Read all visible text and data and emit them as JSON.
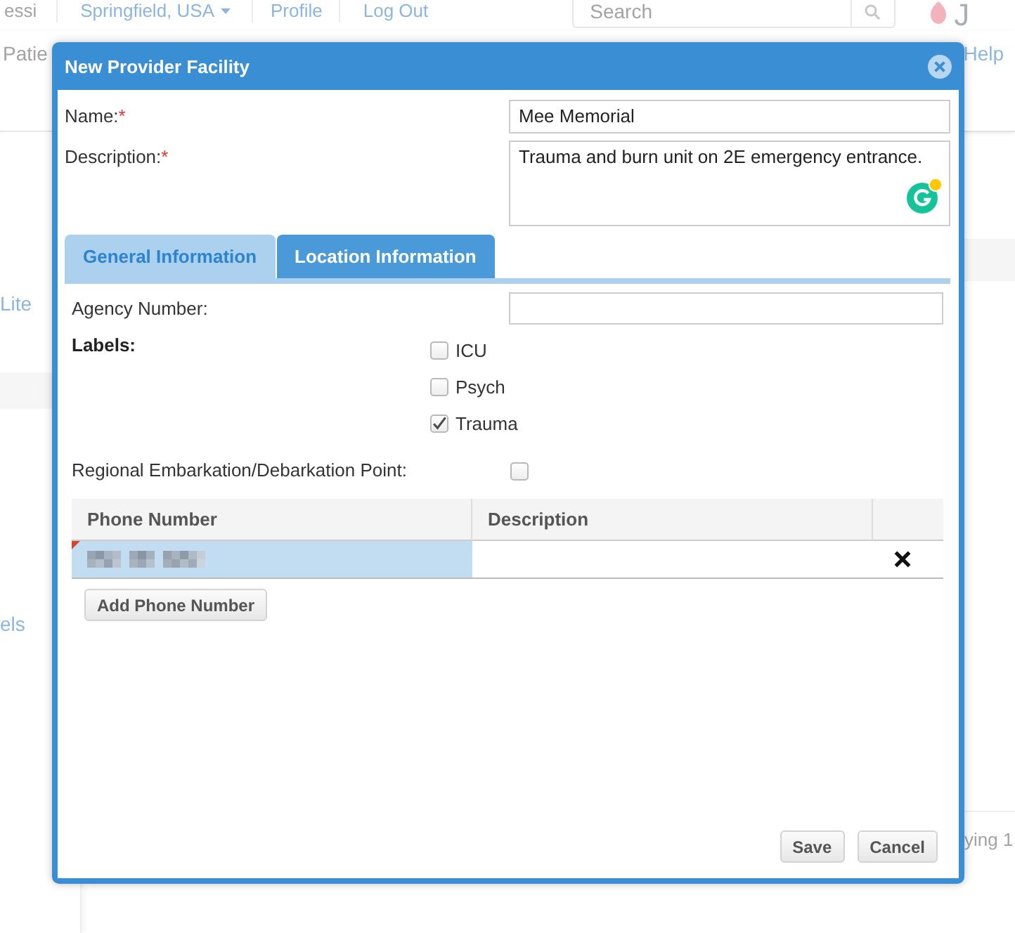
{
  "background_page": {
    "header": {
      "user_name": "essi",
      "location": "Springfield, USA",
      "links": [
        "Profile",
        "Log Out"
      ],
      "search": {
        "placeholder": "Search"
      },
      "logo_text": "J"
    },
    "nav": {
      "tab": "Patie",
      "help": "Help"
    },
    "sidebar": {
      "items": [
        "Lite",
        "els"
      ]
    },
    "pager": "ying 1"
  },
  "dialog": {
    "title": "New Provider Facility",
    "fields": [
      {
        "kind": "input",
        "label": "Name:",
        "required_mark": "*",
        "value": "Mee Memorial"
      },
      {
        "kind": "textarea",
        "label": "Description:",
        "required_mark": "*",
        "value": "Trauma and burn unit on 2E emergency entrance."
      }
    ],
    "tabs": [
      {
        "label": "General Information",
        "selected": true
      },
      {
        "label": "Location Information",
        "selected": false
      }
    ],
    "general_panel": {
      "agency_number": {
        "label": "Agency Number:"
      },
      "labels": {
        "label": "Labels:",
        "options": [
          {
            "label": "ICU",
            "checked": false
          },
          {
            "label": "Psych",
            "checked": false
          },
          {
            "label": "Trauma",
            "checked": true
          }
        ]
      },
      "embarkation_point": {
        "label": "Regional Embarkation/Debarkation Point:",
        "checked": false
      },
      "phone_table": {
        "columns": [
          "Phone Number",
          "Description"
        ],
        "rows": [
          {
            "phone_redacted": true,
            "selected": true,
            "modified": true
          }
        ]
      },
      "add_button": "Add Phone Number"
    },
    "buttons": [
      "Save",
      "Cancel"
    ]
  }
}
